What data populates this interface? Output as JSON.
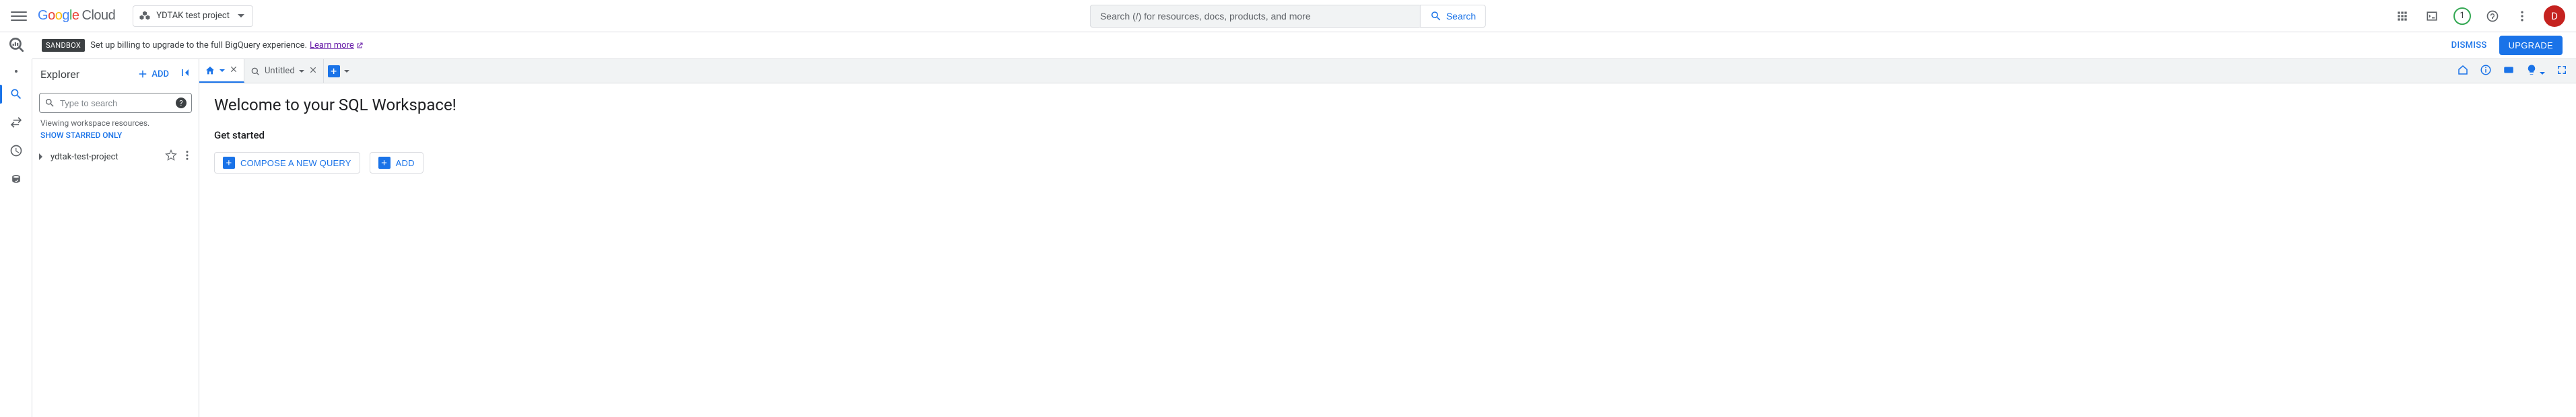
{
  "header": {
    "logo_cloud": "Cloud",
    "project_name": "YDTAK test project",
    "search_placeholder": "Search (/) for resources, docs, products, and more",
    "search_button": "Search",
    "notification_count": "1",
    "avatar_initial": "D"
  },
  "notice": {
    "badge": "SANDBOX",
    "text": "Set up billing to upgrade to the full BigQuery experience.",
    "link": "Learn more",
    "dismiss": "DISMISS",
    "upgrade": "UPGRADE"
  },
  "explorer": {
    "title": "Explorer",
    "add": "ADD",
    "search_placeholder": "Type to search",
    "viewing_text": "Viewing workspace resources.",
    "starred_link": "SHOW STARRED ONLY",
    "project_row": "ydtak-test-project"
  },
  "tabs": {
    "untitled_label": "Untitled"
  },
  "workspace": {
    "welcome_title": "Welcome to your SQL Workspace!",
    "get_started": "Get started",
    "compose_btn": "COMPOSE A NEW QUERY",
    "add_btn": "ADD"
  }
}
